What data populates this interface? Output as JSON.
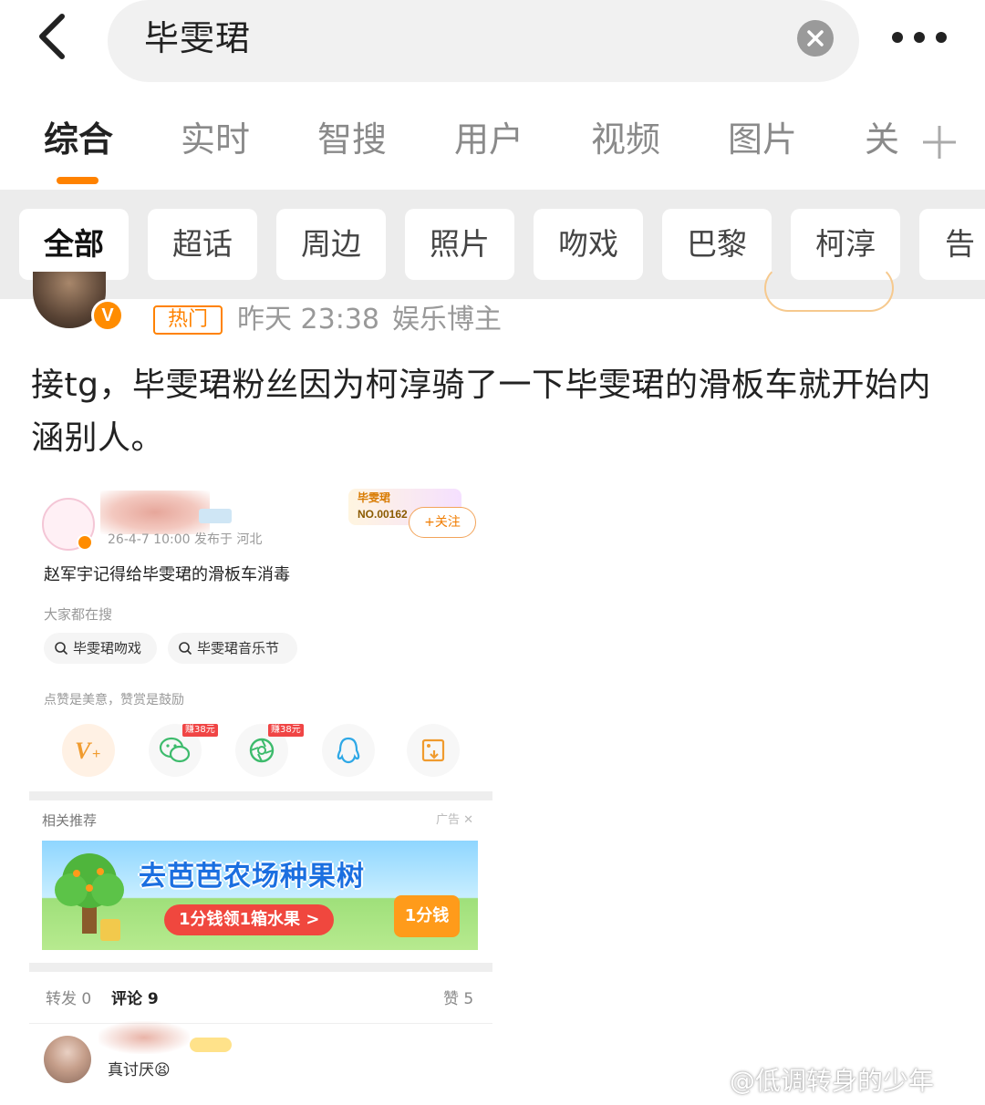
{
  "search": {
    "query": "毕雯珺"
  },
  "tabs": [
    {
      "label": "综合"
    },
    {
      "label": "实时"
    },
    {
      "label": "智搜"
    },
    {
      "label": "用户"
    },
    {
      "label": "视频"
    },
    {
      "label": "图片"
    },
    {
      "label": "关"
    }
  ],
  "chips": [
    {
      "label": "全部"
    },
    {
      "label": "超话"
    },
    {
      "label": "周边"
    },
    {
      "label": "照片"
    },
    {
      "label": "吻戏"
    },
    {
      "label": "巴黎"
    },
    {
      "label": "柯淳"
    },
    {
      "label": "告"
    }
  ],
  "post": {
    "verified_badge": "V",
    "hot_label": "热门",
    "time": "昨天 23:38",
    "role": "娱乐博主",
    "text": "接tg，毕雯珺粉丝因为柯淳骑了一下毕雯珺的滑板车就开始内涵别人。"
  },
  "embedded": {
    "time_location": "26-4-7 10:00  发布于 河北",
    "fan_title": "毕雯珺",
    "fan_no": "NO.00162",
    "follow_label": "+关注",
    "body": "赵军宇记得给毕雯珺的滑板车消毒",
    "search_label": "大家都在搜",
    "search_queries": [
      "毕雯珺吻戏",
      "毕雯珺音乐节"
    ],
    "like_label": "点赞是美意，赞赏是鼓励",
    "earn_labels": [
      "赚38元",
      "赚38元"
    ],
    "share_icons": [
      "v-plus-icon",
      "wechat-icon",
      "moments-icon",
      "qq-icon",
      "save-image-icon"
    ],
    "rec_label": "相关推荐",
    "ad_label": "广告",
    "banner": {
      "title": "去芭芭农场种果树",
      "cta": "1分钱领1箱水果 >",
      "price": "1分钱"
    },
    "stats": {
      "repost": "转发 0",
      "comment": "评论 9",
      "like": "赞 5"
    },
    "comment_text": "真讨厌😫"
  },
  "watermark": "@低调转身的少年",
  "colors": {
    "accent": "#ff8200",
    "chip_bg": "#ececec",
    "search_bg": "#f1f1f1"
  }
}
